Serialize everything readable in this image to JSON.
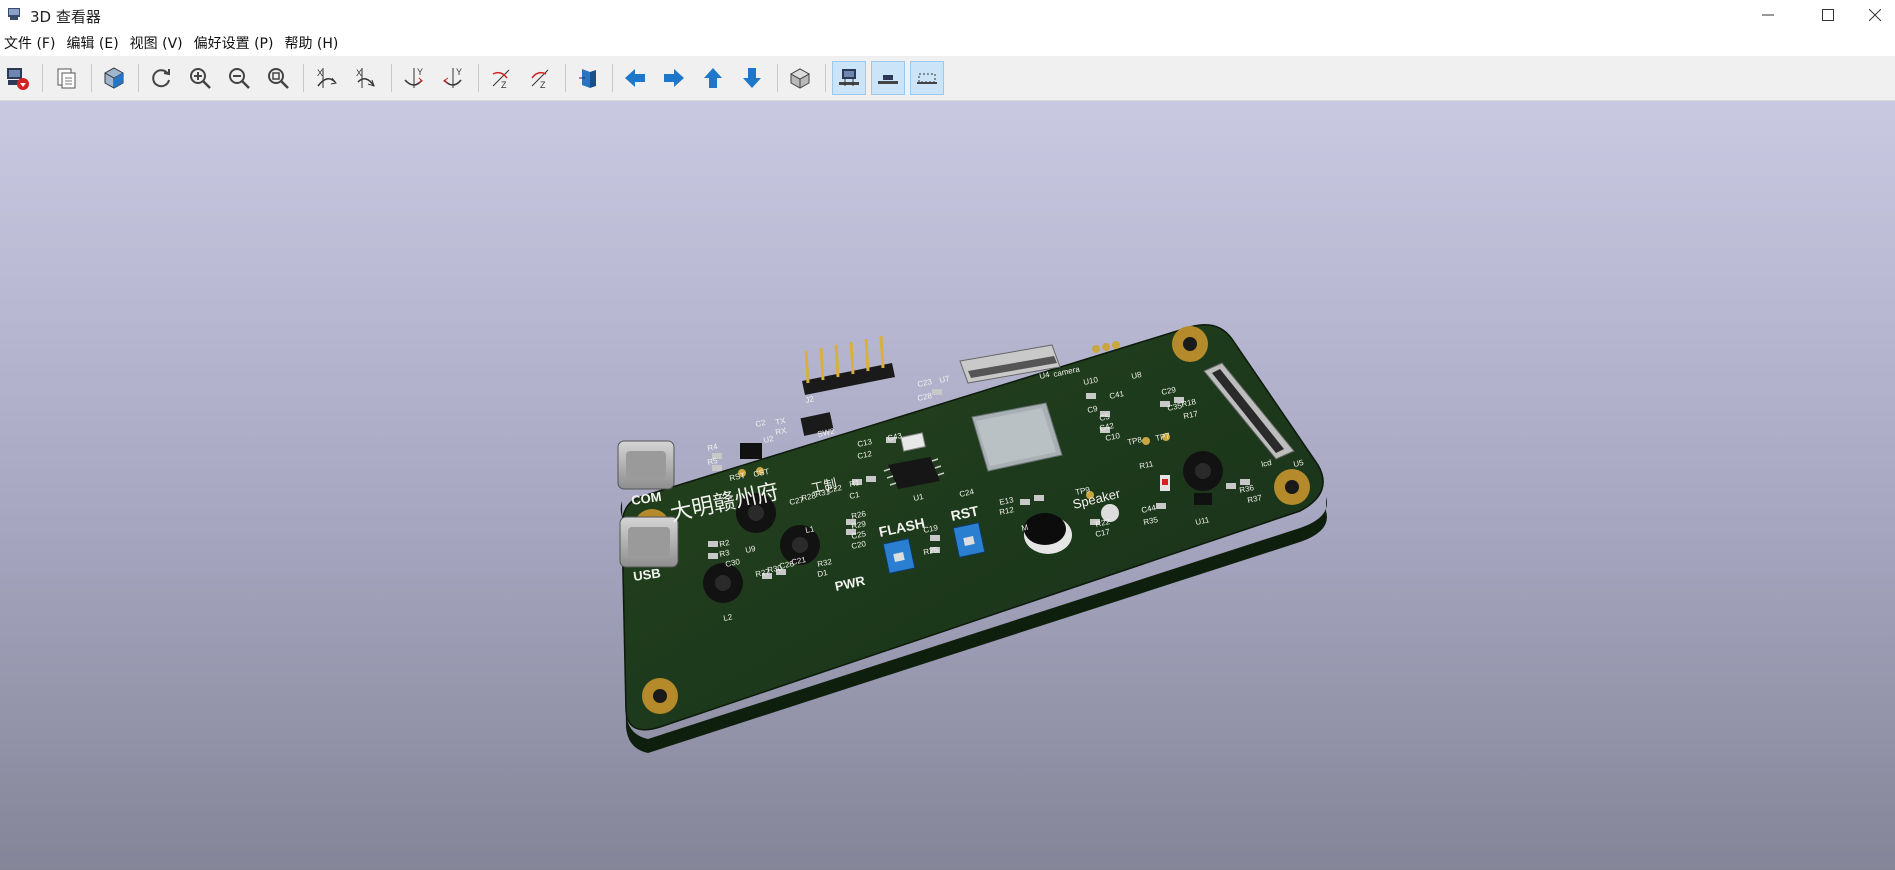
{
  "window": {
    "title": "3D 查看器",
    "icon": "kicad-3d-viewer-icon"
  },
  "menu": [
    {
      "label": "文件 (F)"
    },
    {
      "label": "编辑 (E)"
    },
    {
      "label": "视图 (V)"
    },
    {
      "label": "偏好设置 (P)"
    },
    {
      "label": "帮助 (H)"
    }
  ],
  "toolbar": {
    "buttons": [
      {
        "name": "render-raytracing-icon"
      },
      {
        "name": "copy-to-clipboard-icon"
      },
      {
        "name": "view-3d-cube-icon"
      },
      {
        "name": "reload-icon"
      },
      {
        "name": "zoom-in-icon"
      },
      {
        "name": "zoom-out-icon"
      },
      {
        "name": "zoom-fit-icon"
      },
      {
        "name": "rotate-x-cw-icon"
      },
      {
        "name": "rotate-x-ccw-icon"
      },
      {
        "name": "rotate-y-cw-icon"
      },
      {
        "name": "rotate-y-ccw-icon"
      },
      {
        "name": "rotate-z-cw-icon"
      },
      {
        "name": "rotate-z-ccw-icon"
      },
      {
        "name": "flip-board-icon"
      },
      {
        "name": "pan-left-icon"
      },
      {
        "name": "pan-right-icon"
      },
      {
        "name": "pan-up-icon"
      },
      {
        "name": "pan-down-icon"
      },
      {
        "name": "orthographic-icon"
      },
      {
        "name": "toggle-through-hole-models-icon"
      },
      {
        "name": "toggle-smd-models-icon"
      },
      {
        "name": "toggle-virtual-models-icon"
      }
    ],
    "accent_color": "#1f77c9",
    "active_color": "#cce4f7"
  },
  "board": {
    "color": "#1e3a18",
    "silkscreen": {
      "title": "大明赣州府",
      "maker": "工制",
      "COM": "COM",
      "USB": "USB",
      "FLASH": "FLASH",
      "RST": "RST",
      "PWR": "PWR",
      "Speaker": "Speaker",
      "camera": "camera",
      "lcd": "lcd",
      "labels": [
        "C23",
        "U7",
        "C28",
        "J2",
        "C2",
        "TX",
        "RX",
        "SW2",
        "U2",
        "R4",
        "R5",
        "RST",
        "CST",
        "C13",
        "C12",
        "C43",
        "R1",
        "C1",
        "U1",
        "U4",
        "U10",
        "U8",
        "C41",
        "C29",
        "C35",
        "R18",
        "R17",
        "C9",
        "C5",
        "C42",
        "C10",
        "TP8",
        "TP7",
        "R11",
        "U5",
        "C24",
        "C27",
        "R28",
        "R31",
        "C22",
        "R26",
        "R29",
        "C25",
        "C20",
        "C19",
        "R25",
        "R2",
        "R3",
        "C30",
        "U9",
        "R27",
        "R30",
        "C26",
        "C21",
        "L1",
        "L2",
        "R32",
        "D1",
        "E13",
        "R12",
        "TP9",
        "R22",
        "C17",
        "C44",
        "R35",
        "R36",
        "R37",
        "U11",
        "M"
      ]
    }
  }
}
